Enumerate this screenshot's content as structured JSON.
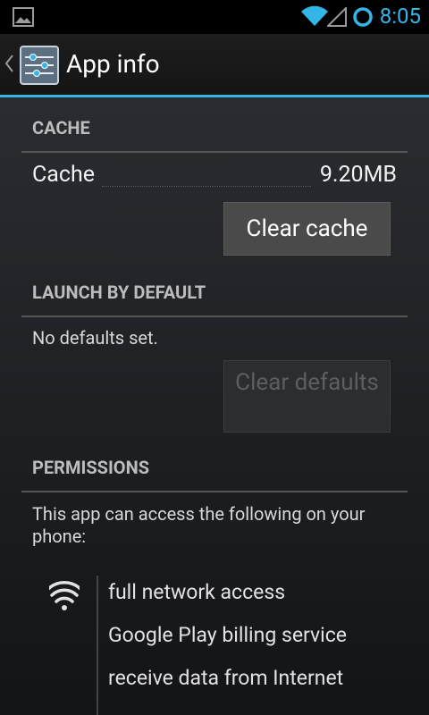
{
  "status_bar": {
    "time": "8:05",
    "icons": [
      "gallery-icon",
      "wifi-icon",
      "signal-icon",
      "sync-ring-icon"
    ],
    "accent_color": "#33b5e5"
  },
  "action_bar": {
    "title": "App info",
    "icons": [
      "up-caret-icon",
      "settings-app-icon"
    ]
  },
  "sections": {
    "cache": {
      "header": "CACHE",
      "label": "Cache",
      "value": "9.20MB",
      "button": "Clear cache"
    },
    "launch": {
      "header": "LAUNCH BY DEFAULT",
      "text": "No defaults set.",
      "button": "Clear defaults"
    },
    "permissions": {
      "header": "PERMISSIONS",
      "text": "This app can access the following on your phone:",
      "group_icon": "wifi-icon",
      "items": [
        "full network access",
        "Google Play billing service",
        "receive data from Internet"
      ]
    }
  }
}
